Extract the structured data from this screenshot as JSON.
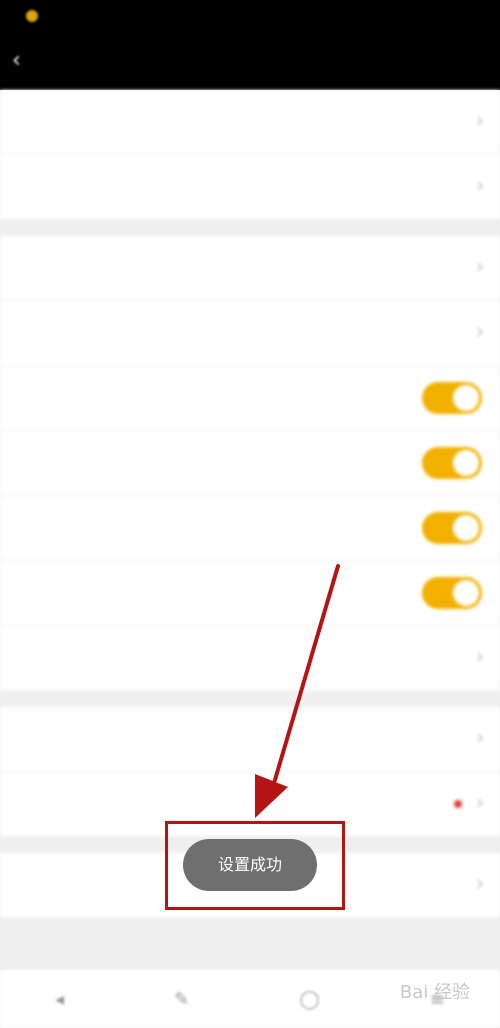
{
  "status_bar": {
    "left_text": "",
    "right_text": ""
  },
  "header": {
    "title": "",
    "back_icon": "chevron-left-icon"
  },
  "groups": [
    {
      "rows": [
        {
          "label": "",
          "control": "chevron"
        },
        {
          "label": "",
          "control": "chevron"
        }
      ]
    },
    {
      "rows": [
        {
          "label": "",
          "control": "chevron"
        },
        {
          "label": "",
          "control": "chevron"
        },
        {
          "label": "",
          "control": "toggle",
          "on": true
        },
        {
          "label": "",
          "control": "toggle",
          "on": true
        },
        {
          "label": "",
          "control": "toggle",
          "on": true
        },
        {
          "label": "",
          "control": "toggle",
          "on": true
        },
        {
          "label": "",
          "control": "value",
          "value": ""
        }
      ]
    },
    {
      "rows": [
        {
          "label": "",
          "control": "chevron"
        },
        {
          "label": "",
          "control": "reddot"
        }
      ]
    },
    {
      "rows": [
        {
          "label": "",
          "control": "value",
          "value": ""
        }
      ]
    }
  ],
  "toast": {
    "text": "设置成功"
  },
  "annotation": {
    "color": "#b41414"
  },
  "colors": {
    "accent": "#f2b100",
    "nav_bg": "#000000"
  },
  "watermark": {
    "text": "Bai  经验"
  }
}
